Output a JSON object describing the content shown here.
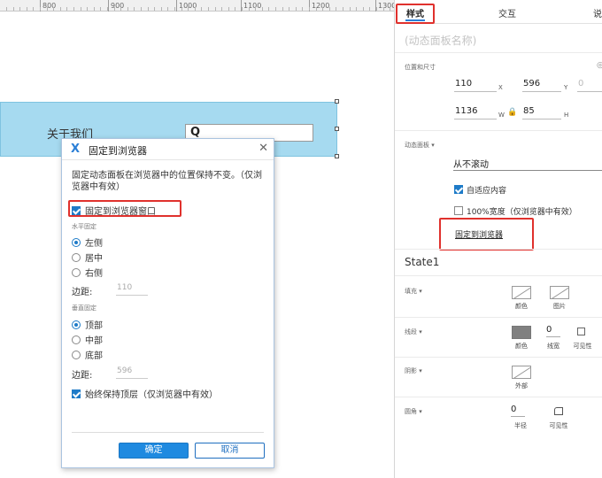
{
  "ruler": {
    "labels": [
      "800",
      "900",
      "1000",
      "1100",
      "1200",
      "1300"
    ]
  },
  "canvas": {
    "about_text": "关于我们",
    "search_icon": "search-icon"
  },
  "dialog": {
    "logo": "X",
    "title": "固定到浏览器",
    "close": "✕",
    "description": "固定动态面板在浏览器中的位置保持不变。（仅浏览器中有效）",
    "pin_checkbox_label": "固定到浏览器窗口",
    "horizontal_section": "水平固定",
    "h_options": [
      "左侧",
      "居中",
      "右侧"
    ],
    "h_selected": "左侧",
    "margin_label": "边距:",
    "h_margin": "110",
    "vertical_section": "垂直固定",
    "v_options": [
      "顶部",
      "中部",
      "底部"
    ],
    "v_selected": "顶部",
    "v_margin": "596",
    "always_top_label": "始终保持顶层（仅浏览器中有效）",
    "ok_label": "确定",
    "cancel_label": "取消"
  },
  "panel": {
    "tabs": [
      "样式",
      "交互",
      "说"
    ],
    "active_tab": "样式",
    "panel_name_placeholder": "(动态面板名称)",
    "pos_size_title": "位置和尺寸",
    "x": "110",
    "x_axis": "X",
    "y": "596",
    "y_axis": "Y",
    "z": "0",
    "w": "1136",
    "w_axis": "W",
    "h": "85",
    "h_axis": "H",
    "dp_title": "动态面板 ▾",
    "scroll_value": "从不滚动",
    "fit_content_label": "自适应内容",
    "full_width_label": "100%宽度（仅浏览器中有效）",
    "pin_link": "固定到浏览器",
    "state_name": "State1",
    "fill_title": "填充 ▾",
    "fill_color_cap": "颜色",
    "fill_image_cap": "图片",
    "stroke_title": "线段 ▾",
    "stroke_color_cap": "颜色",
    "stroke_width_value": "0",
    "stroke_width_cap": "线宽",
    "stroke_vis_cap": "可见性",
    "shadow_title": "阴影 ▾",
    "shadow_outer_cap": "外部",
    "corner_title": "圆角 ▾",
    "corner_radius_value": "0",
    "corner_radius_cap": "半径",
    "corner_vis_cap": "可见性"
  },
  "colors": {
    "accent": "#1e7bc8",
    "highlight": "#e0312d",
    "panel_fill": "#a6daf0"
  }
}
